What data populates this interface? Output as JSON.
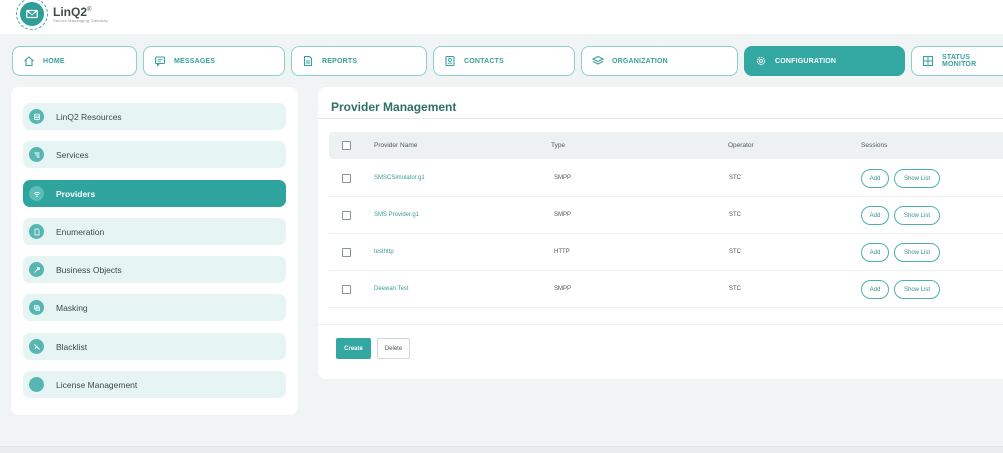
{
  "brand": {
    "name": "LinQ2",
    "mark": "®",
    "tagline": "Secure Messaging Gateway"
  },
  "nav": [
    {
      "label": "HOME",
      "icon": "home-icon"
    },
    {
      "label": "MESSAGES",
      "icon": "message-icon"
    },
    {
      "label": "REPORTS",
      "icon": "document-icon"
    },
    {
      "label": "CONTACTS",
      "icon": "contact-card-icon"
    },
    {
      "label": "ORGANIZATION",
      "icon": "layers-icon"
    },
    {
      "label": "CONFIGURATION",
      "icon": "gear-icon",
      "active": true
    },
    {
      "label": "STATUS MONITOR",
      "icon": "grid-icon"
    }
  ],
  "sidebar": {
    "items": [
      {
        "label": "LinQ2 Resources",
        "icon": "database-icon"
      },
      {
        "label": "Services",
        "icon": "list-icon"
      },
      {
        "label": "Providers",
        "icon": "wifi-icon",
        "active": true
      },
      {
        "label": "Enumeration",
        "icon": "document-icon"
      },
      {
        "label": "Business Objects",
        "icon": "tag-icon"
      },
      {
        "label": "Masking",
        "icon": "copy-icon"
      },
      {
        "label": "Blacklist",
        "icon": "block-icon"
      },
      {
        "label": "License Management",
        "icon": "circle-icon"
      }
    ]
  },
  "main": {
    "title": "Provider Management",
    "columns": [
      "Provider Name",
      "Type",
      "Operator",
      "Sessions"
    ],
    "rows": [
      {
        "name": "SMSCSimulator.g1",
        "type": "SMPP",
        "operator": "STC"
      },
      {
        "name": "SMS Provider.g1",
        "type": "SMPP",
        "operator": "STC"
      },
      {
        "name": "testhttp",
        "type": "HTTP",
        "operator": "STC"
      },
      {
        "name": "Deewan Test",
        "type": "SMPP",
        "operator": "STC"
      }
    ],
    "row_actions": {
      "add_label": "Add",
      "show_list_label": "Show List"
    },
    "create_label": "Create",
    "delete_label": "Delete"
  },
  "colors": {
    "accent": "#33a8a3",
    "accent_light": "#e6f5f3",
    "title": "#2e6e6b",
    "background": "#f1f4f4"
  }
}
